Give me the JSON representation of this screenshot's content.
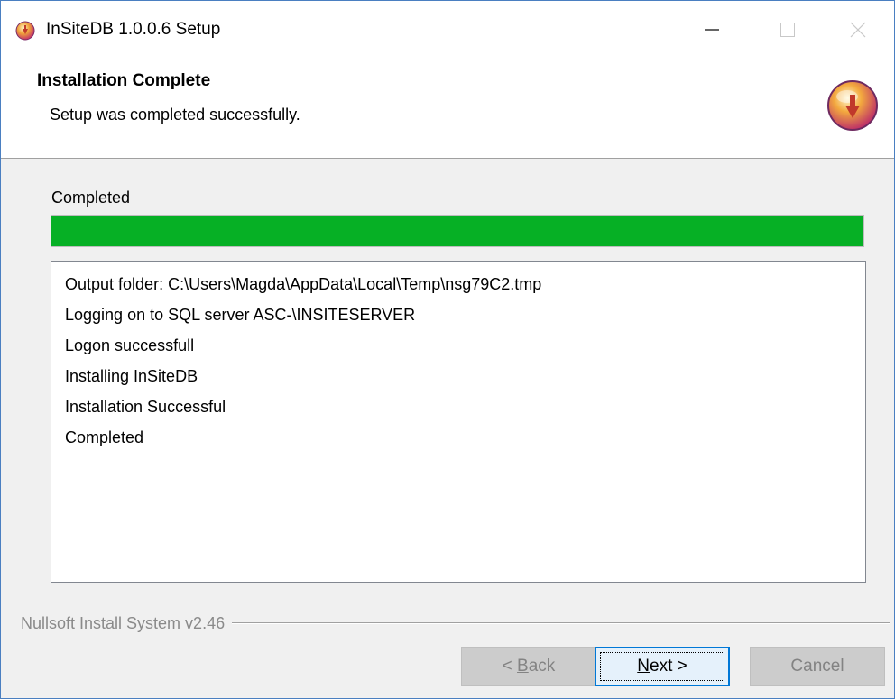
{
  "window": {
    "title": "InSiteDB 1.0.0.6 Setup",
    "controls": {
      "minimize": "minimize-icon",
      "maximize": "maximize-icon",
      "close": "close-icon"
    }
  },
  "header": {
    "title": "Installation Complete",
    "subtitle": "Setup was completed successfully.",
    "icon": "installer-icon"
  },
  "progress": {
    "label": "Completed",
    "value": 1.0,
    "color": "#06b025"
  },
  "log": {
    "items": [
      "Output folder: C:\\Users\\Magda\\AppData\\Local\\Temp\\nsg79C2.tmp",
      "Logging on to SQL server ASC-\\INSITESERVER",
      "Logon successfull",
      "Installing InSiteDB",
      "Installation Successful",
      "Completed"
    ]
  },
  "branding": {
    "text": "Nullsoft Install System v2.46"
  },
  "buttons": {
    "back": {
      "accel": "B",
      "rest": "ack",
      "prefix": "< ",
      "enabled": false
    },
    "next": {
      "accel": "N",
      "rest": "ext >",
      "enabled": true
    },
    "cancel": {
      "label": "Cancel",
      "enabled": false
    }
  },
  "colors": {
    "accent": "#0078d7",
    "window_border": "#4a7fc1"
  }
}
